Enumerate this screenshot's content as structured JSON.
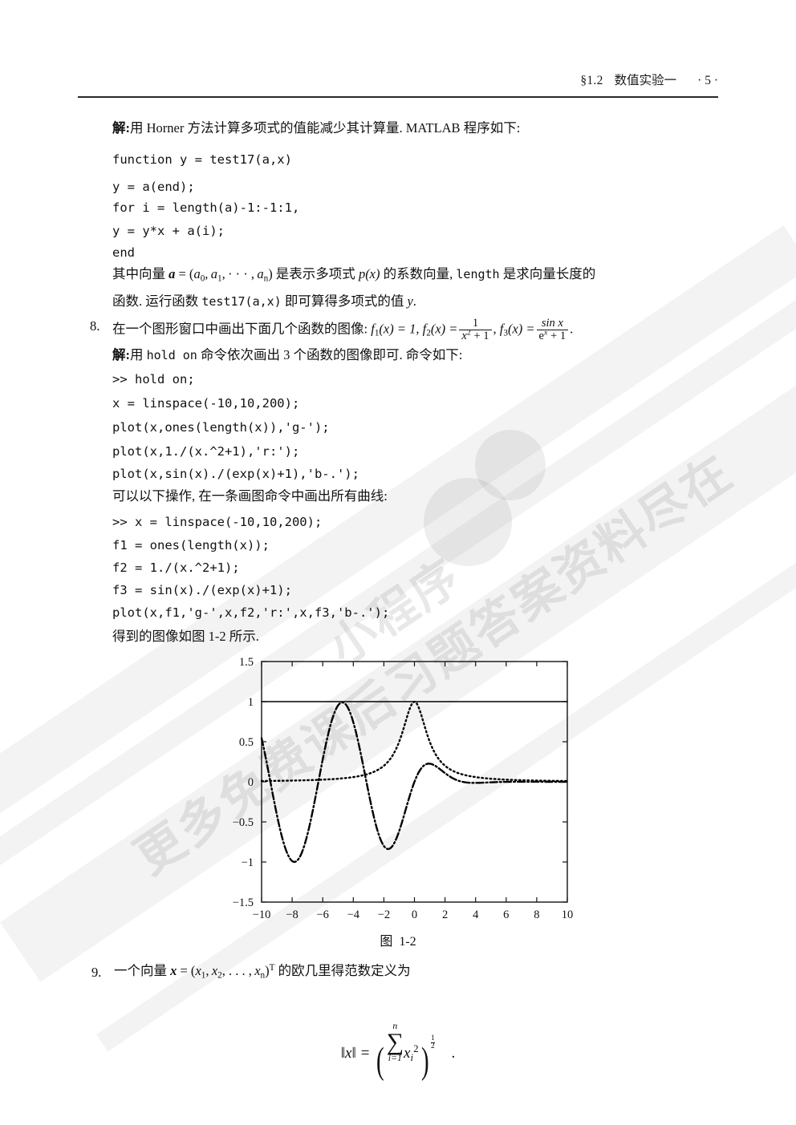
{
  "header": {
    "section": "§1.2",
    "title": "数值实验一",
    "page_number": "· 5 ·"
  },
  "solution_7": {
    "label": "解:",
    "text": "用 Horner 方法计算多项式的值能减少其计算量. MATLAB 程序如下:",
    "code": [
      "function y = test17(a,x)",
      "    y = a(end);",
      "    for i = length(a)-1:-1:1,",
      "        y = y*x + a(i);",
      "    end"
    ],
    "paragraph_line1_pre": "其中向量 ",
    "paragraph_line1_vec": "a",
    "paragraph_line1_eq": " = (",
    "paragraph_line1_a0": "a",
    "paragraph_line1_a0sub": "0",
    "paragraph_line1_a1": "a",
    "paragraph_line1_a1sub": "1",
    "paragraph_line1_dots": "· · · ,",
    "paragraph_line1_an": "a",
    "paragraph_line1_ansub": "n",
    "paragraph_line1_mid": ") 是表示多项式 ",
    "paragraph_line1_px": "p(x)",
    "paragraph_line1_mid2": " 的系数向量, ",
    "paragraph_line1_length": "length",
    "paragraph_line1_end": " 是求向量长度的",
    "paragraph_line2_pre": "函数. 运行函数 ",
    "paragraph_line2_fn": "test17(a,x)",
    "paragraph_line2_mid": " 即可算得多项式的值 ",
    "paragraph_line2_y": "y",
    "paragraph_line2_end": "."
  },
  "problem_8": {
    "number": "8.",
    "text_pre": "在一个图形窗口中画出下面几个函数的图像: ",
    "f1": "f",
    "f1_sub": "1",
    "f1_eq": "(x) = 1,",
    "f2_name": "f",
    "f2_sub": "2",
    "f2_eq": "(x) =",
    "f2_num": "1",
    "f2_den_x": "x",
    "f2_den_sup": "2",
    "f2_den_rest": "+ 1",
    "comma": ",",
    "f3_name": "f",
    "f3_sub": "3",
    "f3_eq": "(x) =",
    "f3_num": "sin x",
    "f3_den_e": "e",
    "f3_den_sup": "x",
    "f3_den_rest": "+ 1",
    "period": ".",
    "solution_label": "解:",
    "solution_text_pre": "用 ",
    "solution_text_cmd": "hold on",
    "solution_text_post": " 命令依次画出 3 个函数的图像即可. 命令如下:",
    "code_block_1": [
      ">> hold on;",
      "   x = linspace(-10,10,200);",
      "   plot(x,ones(length(x)),'g-');",
      "   plot(x,1./(x.^2+1),'r:');",
      "   plot(x,sin(x)./(exp(x)+1),'b-.');"
    ],
    "middle_text": "可以以下操作, 在一条画图命令中画出所有曲线:",
    "code_block_2": [
      ">> x  = linspace(-10,10,200);",
      "   f1 = ones(length(x));",
      "   f2 = 1./(x.^2+1);",
      "   f3 = sin(x)./(exp(x)+1);",
      "   plot(x,f1,'g-',x,f2,'r:',x,f3,'b-.');"
    ],
    "closing_text_pre": "得到的图像如图 ",
    "closing_text_num": "1-2",
    "closing_text_post": " 所示."
  },
  "figure": {
    "caption_label": "图",
    "caption_number": "1-2"
  },
  "chart_data": {
    "type": "line",
    "title": "",
    "xlabel": "",
    "ylabel": "",
    "xlim": [
      -10,
      10
    ],
    "ylim": [
      -1.5,
      1.5
    ],
    "xticks": [
      -10,
      -8,
      -6,
      -4,
      -2,
      0,
      2,
      4,
      6,
      8,
      10
    ],
    "xticklabels": [
      "-10",
      "-8",
      "-6",
      "-4",
      "-2",
      "0",
      "2",
      "4",
      "6",
      "8",
      "10"
    ],
    "yticks": [
      -1.5,
      -1,
      -0.5,
      0,
      0.5,
      1,
      1.5
    ],
    "yticklabels": [
      "-1.5",
      "-1",
      "-0.5",
      "0",
      "0.5",
      "1",
      "1.5"
    ],
    "grid": false,
    "legend": "none",
    "box": true,
    "n_points": 200,
    "series": [
      {
        "name": "f1(x) = 1",
        "style": "solid",
        "matlab_spec": "g-",
        "color": "#000000",
        "constant": 1
      },
      {
        "name": "f2(x) = 1/(x^2+1)",
        "style": "dotted",
        "matlab_spec": "r:",
        "color": "#000000",
        "formula": "1/(x*x+1)"
      },
      {
        "name": "f3(x) = sin(x)/(e^x+1)",
        "style": "dashdot",
        "matlab_spec": "b-.",
        "color": "#000000",
        "formula": "sin(x)/(exp(x)+1)"
      }
    ]
  },
  "problem_9": {
    "number": "9.",
    "text_pre": "一个向量 ",
    "vec": "x",
    "eq": " = (",
    "x1": "x",
    "x1sub": "1",
    "x2": "x",
    "x2sub": "2",
    "dots": ", . . . ,",
    "xn": "x",
    "xnsub": "n",
    "close": ")",
    "transpose": "T",
    "text_post": " 的欧几里得范数定义为",
    "formula": {
      "lhs": "‖x‖ =",
      "sum_upper": "n",
      "sum_symbol": "∑",
      "sum_lower": "i=1",
      "term": "x",
      "term_sub": "i",
      "term_sup": "2",
      "exp_num": "1",
      "exp_den": "2",
      "trailing": "."
    }
  },
  "watermark": {
    "line1": "更多免费课后习题答案资料尽在",
    "line2": "小程序"
  }
}
